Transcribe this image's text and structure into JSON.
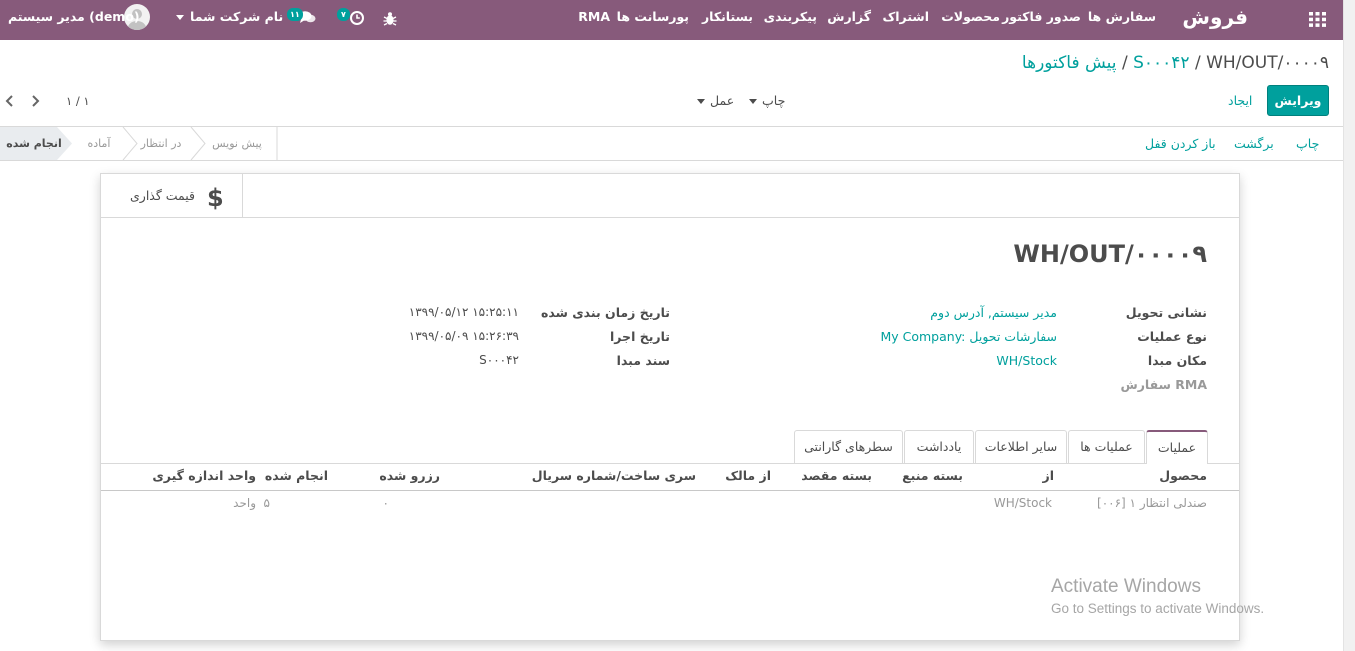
{
  "navbar": {
    "app_title": "فروش",
    "menu": [
      "سفارش ها",
      "صدور فاکتور",
      "محصولات",
      "اشتراک",
      "گزارش",
      "پیکربندی",
      "بستانکار",
      "پورسانت ها",
      "RMA"
    ],
    "messages_count": "۱۱",
    "activities_count": "۷",
    "company": "نام شرکت شما",
    "user": "مدیر سیستم (demo)"
  },
  "breadcrumb": {
    "root": "پیش فاکتورها",
    "sep1": "/",
    "parent": "S۰۰۰۴۲",
    "sep2": "/",
    "current": "WH/OUT/۰۰۰۰۹"
  },
  "controls": {
    "edit": "ویرایش",
    "create": "ایجاد",
    "print": "چاپ",
    "action": "عمل",
    "pager": "۱ / ۱"
  },
  "statusbar": {
    "buttons": [
      "چاپ",
      "برگشت",
      "باز کردن قفل"
    ],
    "stages": [
      "انجام شده",
      "آماده",
      "در انتظار",
      "پیش نویس"
    ],
    "active_stage": "انجام شده"
  },
  "smart_button": {
    "label": "قیمت گذاری",
    "icon": "dollar-icon"
  },
  "record": {
    "name": "WH/OUT/۰۰۰۰۹",
    "right_fields": [
      {
        "label": "نشانی تحویل",
        "value": "مدیر سیستم, آدرس دوم",
        "link": true
      },
      {
        "label": "نوع عملیات",
        "value": "My Company: سفارشات تحویل",
        "link": true
      },
      {
        "label": "مکان مبدا",
        "value": "WH/Stock",
        "link": true
      },
      {
        "label": "سفارش RMA",
        "value": "",
        "link": false
      }
    ],
    "left_fields": [
      {
        "label": "تاریخ زمان بندی شده",
        "value": "۱۳۹۹/۰۵/۱۲ ۱۵:۲۵:۱۱"
      },
      {
        "label": "تاریخ اجرا",
        "value": "۱۳۹۹/۰۵/۰۹ ۱۵:۲۶:۳۹"
      },
      {
        "label": "سند مبدا",
        "value": "S۰۰۰۴۲"
      }
    ]
  },
  "tabs": [
    "عملیات",
    "عملیات ها",
    "سایر اطلاعات",
    "یادداشت",
    "سطرهای گارانتی"
  ],
  "table": {
    "headers": [
      "محصول",
      "از",
      "بسته منبع",
      "بسته مقصد",
      "از مالک",
      "سری ساخت/شماره سریال",
      "رزرو شده",
      "انجام شده",
      "واحد اندازه گیری"
    ],
    "rows": [
      {
        "product": "[۰۰۶] صندلی انتظار ۱",
        "from": "WH/Stock",
        "reserved": "۰",
        "done": "۵",
        "uom": "واحد"
      }
    ]
  },
  "watermark": {
    "title": "Activate Windows",
    "subtitle": "Go to Settings to activate Windows."
  },
  "colors": {
    "brand": "#875a7b",
    "accent": "#00a09d"
  }
}
